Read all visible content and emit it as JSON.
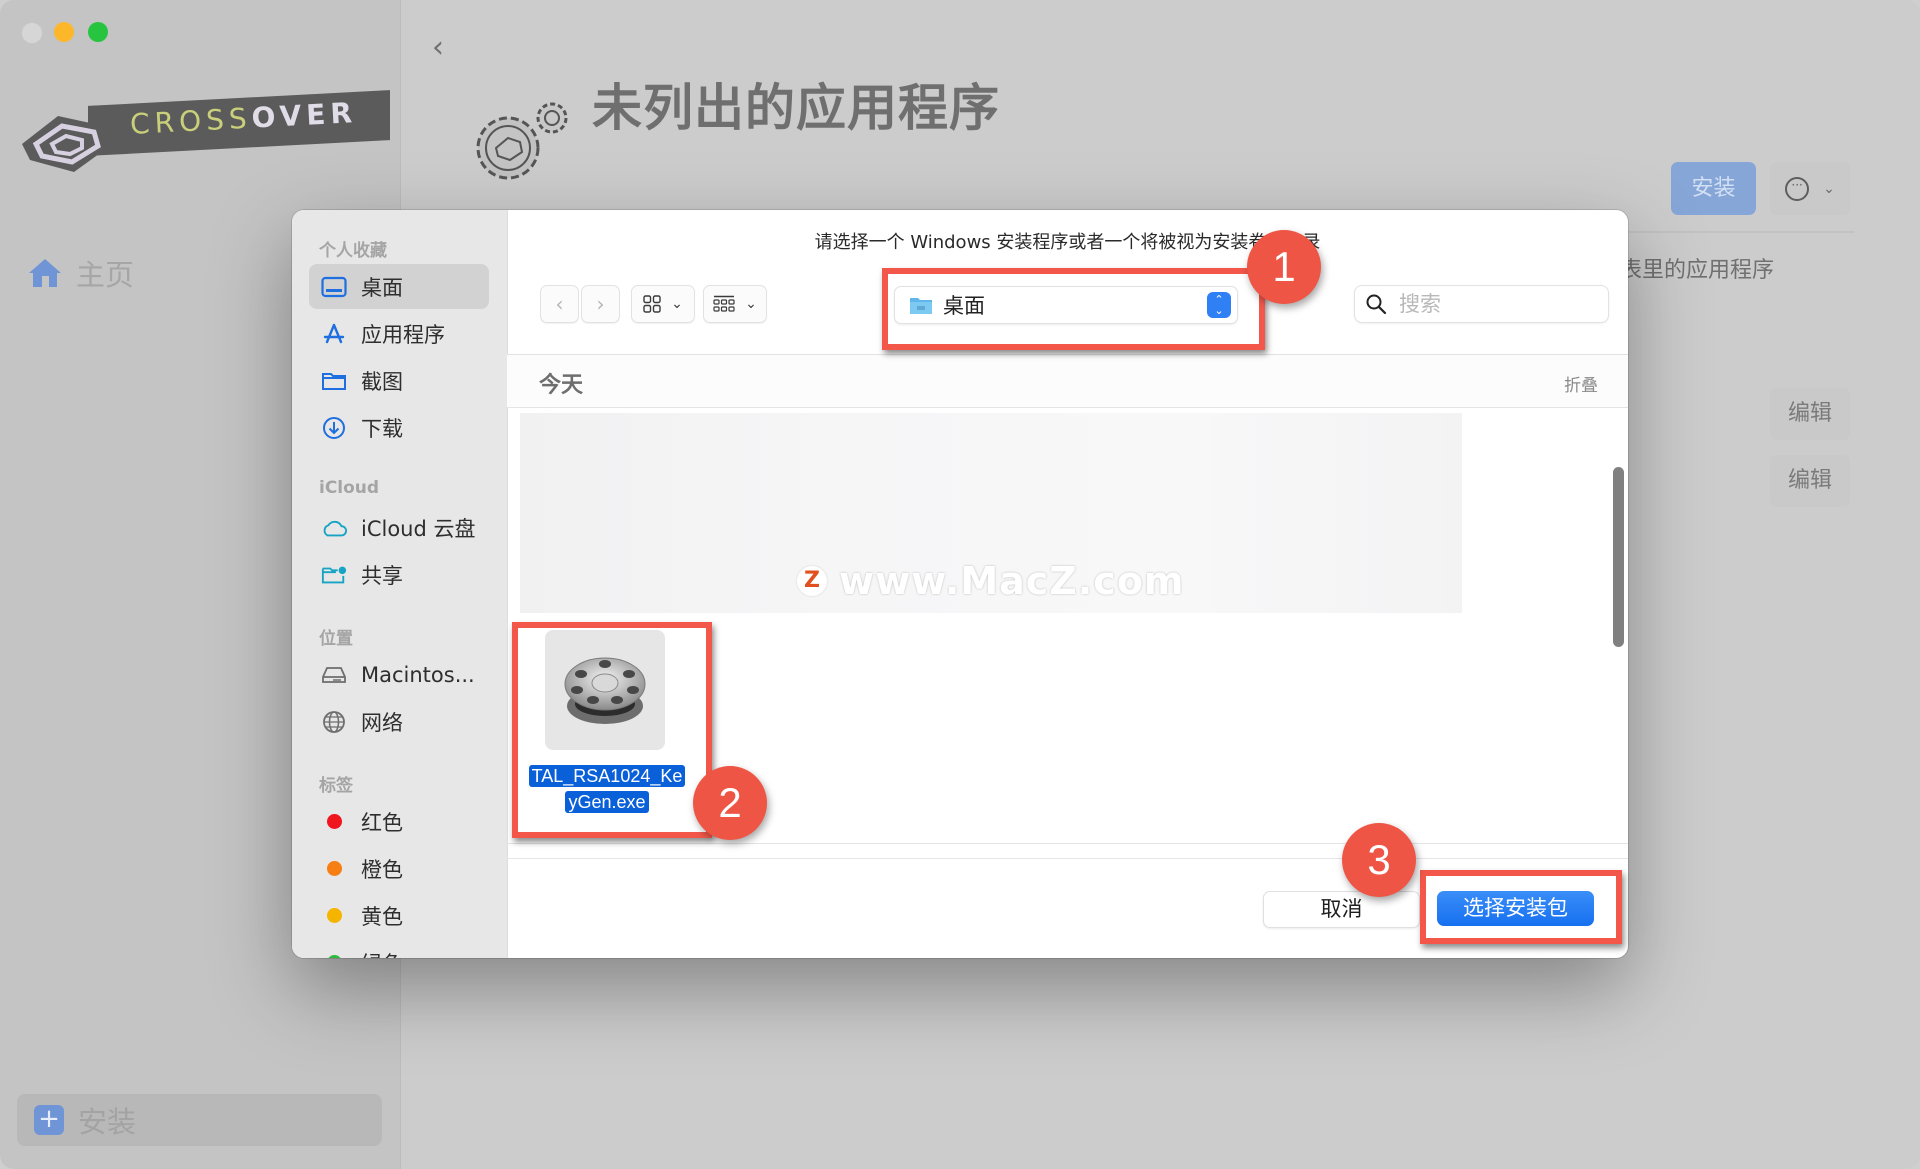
{
  "app": {
    "logo_text_light": "CROSS",
    "logo_text_bold": "OVER",
    "sidebar": {
      "home_label": "主页",
      "install_label": "安装"
    },
    "header": {
      "back_icon": "chevron-left-icon",
      "title": "未列出的应用程序",
      "install_button": "安装",
      "more_icon": "ellipsis-circle-icon"
    },
    "content": {
      "list_text": "表里的应用程序",
      "edit_buttons": [
        "编辑",
        "编辑"
      ]
    }
  },
  "dialog": {
    "prompt": "请选择一个 Windows 安装程序或者一个将被视为安装卷的目录",
    "sidebar": {
      "sections": [
        {
          "title": "个人收藏",
          "items": [
            {
              "label": "桌面",
              "icon": "desktop-icon",
              "selected": true
            },
            {
              "label": "应用程序",
              "icon": "applications-icon"
            },
            {
              "label": "截图",
              "icon": "folder-icon"
            },
            {
              "label": "下载",
              "icon": "download-icon"
            }
          ]
        },
        {
          "title": "iCloud",
          "items": [
            {
              "label": "iCloud 云盘",
              "icon": "cloud-icon"
            },
            {
              "label": "共享",
              "icon": "shared-folder-icon"
            }
          ]
        },
        {
          "title": "位置",
          "items": [
            {
              "label": "Macintos...",
              "icon": "disk-icon"
            },
            {
              "label": "网络",
              "icon": "globe-icon"
            }
          ]
        },
        {
          "title": "标签",
          "items": [
            {
              "label": "红色",
              "color": "#f0161e"
            },
            {
              "label": "橙色",
              "color": "#f67e12"
            },
            {
              "label": "黄色",
              "color": "#f5b400"
            },
            {
              "label": "绿色",
              "color": "#2bbd3a"
            }
          ]
        }
      ]
    },
    "toolbar": {
      "back_icon": "chevron-left-icon",
      "forward_icon": "chevron-right-icon",
      "view_icon": "grid-view-icon",
      "group_icon": "group-by-icon",
      "location": "桌面",
      "search_placeholder": "搜索"
    },
    "group": {
      "title": "今天",
      "collapse_label": "折叠"
    },
    "watermark": {
      "logo": "Z",
      "text": "www.MacZ.com"
    },
    "files": [
      {
        "name_line1": "TAL_RSA1024_Ke",
        "name_line2": "yGen.exe",
        "selected": true
      }
    ],
    "buttons": {
      "cancel": "取消",
      "confirm": "选择安装包"
    }
  },
  "annotations": {
    "badge1": "1",
    "badge2": "2",
    "badge3": "3",
    "color": "#ef5545"
  }
}
